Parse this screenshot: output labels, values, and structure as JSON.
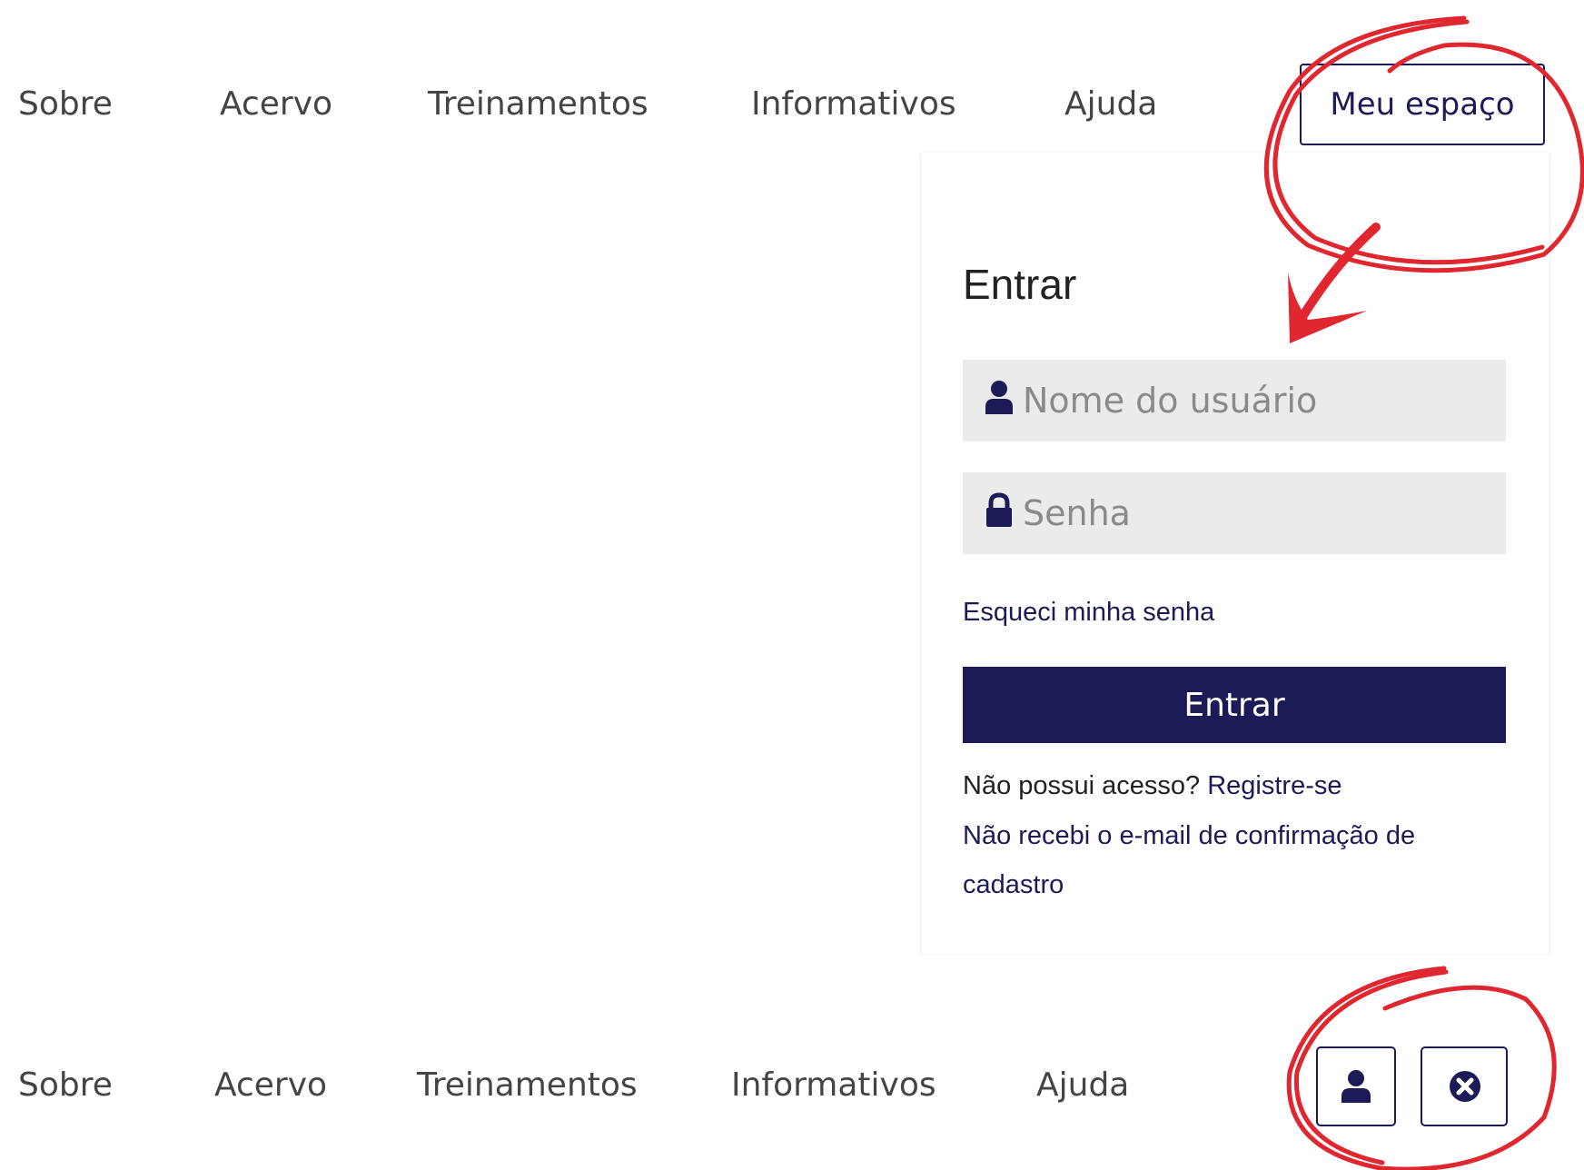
{
  "nav_top": {
    "items": [
      "Sobre",
      "Acervo",
      "Treinamentos",
      "Informativos",
      "Ajuda"
    ],
    "meu_espaco": "Meu espaço"
  },
  "login": {
    "title": "Entrar",
    "username_placeholder": "Nome do usuário",
    "password_placeholder": "Senha",
    "forgot": "Esqueci minha senha",
    "submit": "Entrar",
    "no_access": "Não possui acesso?",
    "register": "Registre-se",
    "no_email": "Não recebi o e-mail de confirmação de cadastro"
  },
  "nav_bottom": {
    "items": [
      "Sobre",
      "Acervo",
      "Treinamentos",
      "Informativos",
      "Ajuda"
    ]
  },
  "icons": {
    "user": "user-icon",
    "lock": "lock-icon",
    "close": "close-circle-icon"
  },
  "colors": {
    "brand": "#1d1b57",
    "annotation": "#e0262e",
    "field_bg": "#ebebeb"
  }
}
